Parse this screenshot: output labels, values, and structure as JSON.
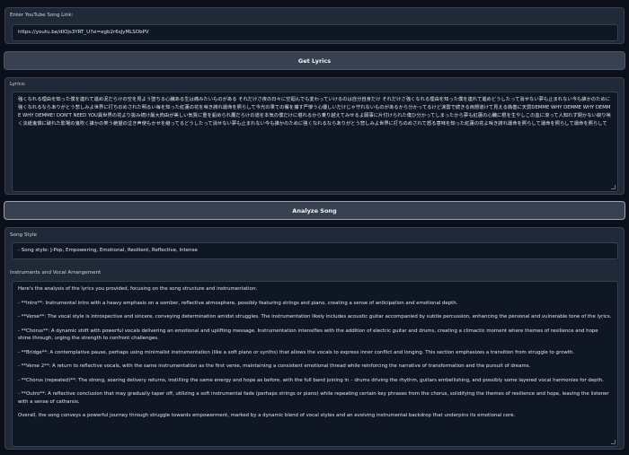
{
  "link_section": {
    "label": "Enter YouTube Song Link:",
    "value": "https://youtu.be/dIOjs3YRT_U?si=egb2r6sJyMLSObPV"
  },
  "get_lyrics_button": "Get Lyrics",
  "lyrics_section": {
    "label": "Lyrics:",
    "text": "強くなれる理由を知った僕を連れて進め泥だらけの空を見よう堕ちる心臓ある生は痛みたいものがある それだけさ夜の日々に空廻んでも変わっていけるのは自分自身だけ それだけさ強くなれる理由を知った僕を連れて進めどうしたって消せない夢も止まれない今も誰かのために強くなれるならありがとう悲しみよ世界に打ちのめされた明るい毎を知った紅蓮の花を咲き誇れ運命を照らして今光の果ての餐を捕す严惨う心優しいだけじゃ守れないものがあるから分かってるけど涙雲で続きる両想道けて見える偽善に天罰DEMME WHY DEMME WHY DEMME WHY DEMME! DON'T NEED YOU異世界の花より抜み続け最大肉由が美しい気質に重を鉛められ鷹だらけの道を本気の僕だけに堪れるから乗り越えてみせるよ願事に片付けられた傷ひ分かってしまったから夢も紅蓮の心臓に根を生やしこの血に滾って人知れず閉かない叙り咲く淡紙鬼憐に破れた影場の鬼吹く誰かの笑う絶望の泣き声使もかせを継ってるどうしたって消せない夢も止まれない今も誰かのために強くなれるならありがとう悲しみよ世界に打ちのめされて怒る意味を知った紅蓮の花よ咲き誇れ運命を照らして運命を照らして運命を照らして"
  },
  "analyze_button": "Analyze Song",
  "style_section": {
    "label": "Song Style",
    "value": "- Song style: J-Pop, Empowering, Emotional, Resilient, Reflective, Intense"
  },
  "arrangement_section": {
    "label": "Instruments and Vocal Arrangement",
    "paragraphs": [
      "Here's the analysis of the lyrics you provided, focusing on the song structure and instrumentation:",
      "- **Intro**: Instrumental intro with a heavy emphasis on a somber, reflective atmosphere, possibly featuring strings and piano, creating a sense of anticipation and emotional depth.",
      "- **Verse**: The vocal style is introspective and sincere, conveying determination amidst struggles. The instrumentation likely includes acoustic guitar accompanied by subtle percussion, enhancing the personal and vulnerable tone of the lyrics.",
      "- **Chorus**: A dynamic shift with powerful vocals delivering an emotional and uplifting message. Instrumentation intensifies with the addition of electric guitar and drums, creating a climactic moment where themes of resilience and hope shine through, urging the strength to confront challenges.",
      "- **Bridge**: A contemplative pause, perhaps using minimalist instrumentation (like a soft piano or synths) that allows the vocals to express inner conflict and longing. This section emphasizes a transition from struggle to growth.",
      "- **Verse 2**: A return to reflective vocals, with the same instrumentation as the first verse, maintaining a consistent emotional thread while reinforcing the narrative of transformation and the pursuit of dreams.",
      "- **Chorus (repeated)**: The strong, soaring delivery returns, instilling the same energy and hope as before, with the full band joining in – drums driving the rhythm, guitars embellishing, and possibly some layered vocal harmonies for depth.",
      "- **Outro**: A reflective conclusion that may gradually taper off, utilizing a soft instrumental fade (perhaps strings or piano) while repeating certain key phrases from the chorus, solidifying the themes of resilience and hope, leaving the listener with a sense of catharsis.",
      "Overall, the song conveys a powerful journey through struggle towards empowerment, marked by a dynamic blend of vocal styles and an evolving instrumental backdrop that underpins its emotional core."
    ]
  }
}
